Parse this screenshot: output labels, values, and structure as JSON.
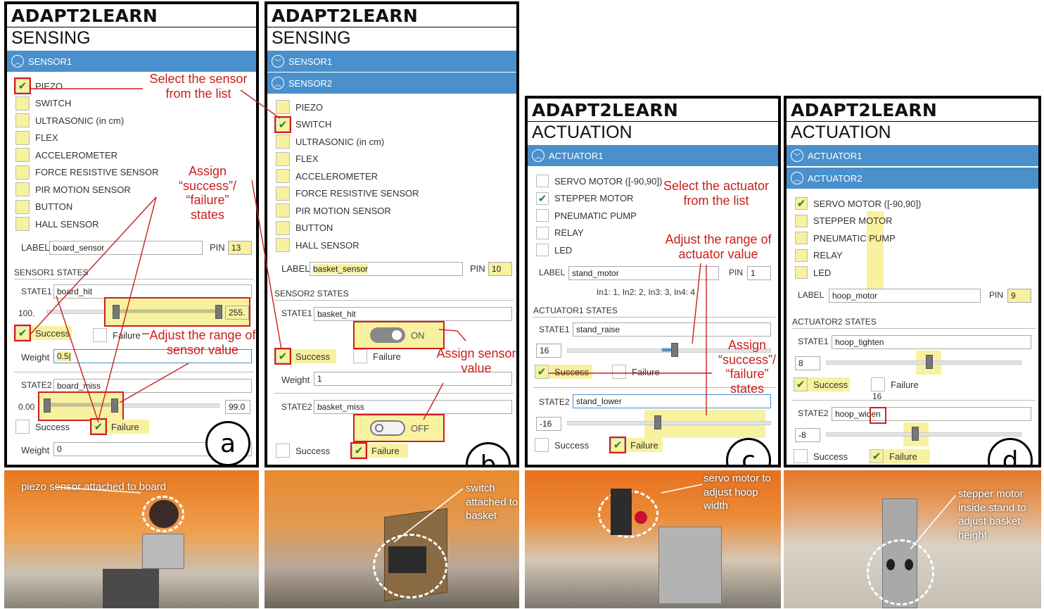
{
  "brand": "ADAPT2LEARN",
  "panel_a": {
    "section": "SENSING",
    "accordion1": "SENSOR1",
    "options": [
      "PIEZO",
      "SWITCH",
      "ULTRASONIC (in cm)",
      "FLEX",
      "ACCELEROMETER",
      "FORCE RESISTIVE SENSOR",
      "PIR MOTION SENSOR",
      "BUTTON",
      "HALL SENSOR"
    ],
    "label_caption": "LABEL",
    "label_value": "board_sensor",
    "pin_caption": "PIN",
    "pin_value": "13",
    "states_header": "SENSOR1 STATES",
    "state1_caption": "STATE1",
    "state1_value": "board_hit",
    "s1_min": "100.",
    "s1_max": "255.",
    "success": "Success",
    "failure": "Failure",
    "weight_caption": "Weight",
    "weight1_value": "0.5|",
    "state2_caption": "STATE2",
    "state2_value": "board_miss",
    "s2_min": "0.00",
    "s2_max": "99.0",
    "weight2_value": "0",
    "letter": "a"
  },
  "panel_b": {
    "section": "SENSING",
    "accordion1": "SENSOR1",
    "accordion2": "SENSOR2",
    "options": [
      "PIEZO",
      "SWITCH",
      "ULTRASONIC (in cm)",
      "FLEX",
      "ACCELEROMETER",
      "FORCE RESISTIVE SENSOR",
      "PIR MOTION SENSOR",
      "BUTTON",
      "HALL SENSOR"
    ],
    "label_caption": "LABEL",
    "label_value": "basket_sensor",
    "pin_caption": "PIN",
    "pin_value": "10",
    "states_header": "SENSOR2 STATES",
    "state1_caption": "STATE1",
    "state1_value": "basket_hit",
    "toggle_on": "ON",
    "toggle_off": "OFF",
    "success": "Success",
    "failure": "Failure",
    "weight_caption": "Weight",
    "weight1_value": "1",
    "state2_caption": "STATE2",
    "state2_value": "basket_miss",
    "letter": "b"
  },
  "panel_c": {
    "section": "ACTUATION",
    "accordion1": "ACTUATOR1",
    "options": [
      "SERVO MOTOR ([-90,90])",
      "STEPPER MOTOR",
      "PNEUMATIC PUMP",
      "RELAY",
      "LED"
    ],
    "label_caption": "LABEL",
    "label_value": "stand_motor",
    "pin_caption": "PIN",
    "pin_value": "1",
    "pins_info": "In1: 1, In2: 2, In3: 3, In4: 4",
    "states_header": "ACTUATOR1 STATES",
    "state1_caption": "STATE1",
    "state1_value": "stand_raise",
    "state1_num": "16",
    "success": "Success",
    "failure": "Failure",
    "state2_caption": "STATE2",
    "state2_value": "stand_lower",
    "state2_num": "-16",
    "letter": "c"
  },
  "panel_d": {
    "section": "ACTUATION",
    "accordion1": "ACTUATOR1",
    "accordion2": "ACTUATOR2",
    "options": [
      "SERVO MOTOR ([-90,90])",
      "STEPPER MOTOR",
      "PNEUMATIC PUMP",
      "RELAY",
      "LED"
    ],
    "label_caption": "LABEL",
    "label_value": "hoop_motor",
    "pin_caption": "PIN",
    "pin_value": "9",
    "states_header": "ACTUATOR2 STATES",
    "state1_caption": "STATE1",
    "state1_value": "hoop_tighten",
    "state1_num": "8",
    "success": "Success",
    "failure": "Failure",
    "below_num": "16",
    "state2_caption": "STATE2",
    "state2_value": "hoop_widen",
    "state2_num": "-8",
    "letter": "d"
  },
  "annotations": {
    "select_sensor": "Select the sensor from the list",
    "assign_states_a": "Assign “success”/ “failure” states",
    "adjust_sensor_range": "Adjust the range of sensor value",
    "assign_sensor_value": "Assign sensor value",
    "select_actuator": "Select the actuator from the list",
    "adjust_actuator_range": "Adjust the range of actuator value",
    "assign_states_c": "Assign “success”/ “failure” states"
  },
  "photos": {
    "a": "piezo sensor attached to board",
    "b": "switch attached to basket",
    "c": "servo motor to adjust hoop width",
    "d": "stepper motor inside stand to adjust basket height"
  },
  "colors": {
    "accent_blue": "#4a90cc",
    "highlight": "#f7f1a0",
    "annotation_red": "#c8201c",
    "check_green": "#2e7d32"
  }
}
